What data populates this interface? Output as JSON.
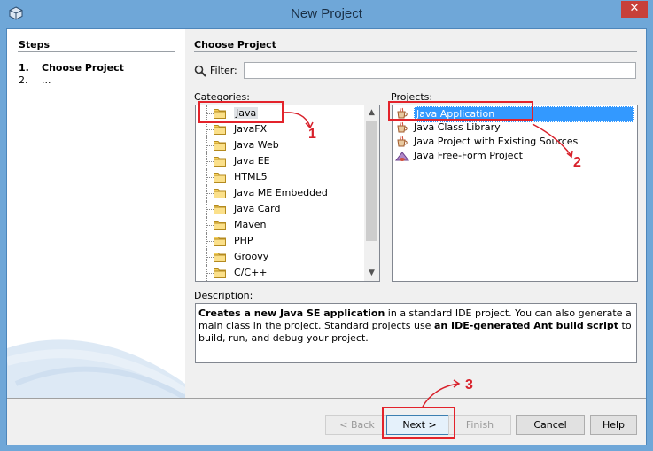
{
  "window": {
    "title": "New Project",
    "close_glyph": "✕"
  },
  "steps": {
    "heading": "Steps",
    "items": [
      {
        "num": "1.",
        "label": "Choose Project"
      },
      {
        "num": "2.",
        "label": "..."
      }
    ]
  },
  "main": {
    "heading": "Choose Project",
    "filter_label": "Filter:",
    "filter_value": "",
    "categories_label": "Categories:",
    "projects_label": "Projects:",
    "categories": [
      "Java",
      "JavaFX",
      "Java Web",
      "Java EE",
      "HTML5",
      "Java ME Embedded",
      "Java Card",
      "Maven",
      "PHP",
      "Groovy",
      "C/C++"
    ],
    "selected_category": "Java",
    "projects": [
      "Java Application",
      "Java Class Library",
      "Java Project with Existing Sources",
      "Java Free-Form Project"
    ],
    "selected_project": "Java Application",
    "description_label": "Description:",
    "description": {
      "b1": "Creates a new Java SE application",
      "t1": " in a standard IDE project. You can also generate a main class in the project. Standard projects use ",
      "b2": "an IDE-generated Ant build script",
      "t2": " to build, run, and debug your project."
    }
  },
  "buttons": {
    "back": "< Back",
    "next": "Next >",
    "finish": "Finish",
    "cancel": "Cancel",
    "help": "Help"
  },
  "annotations": {
    "a1": "1",
    "a2": "2",
    "a3": "3"
  },
  "colors": {
    "accent": "#3399ff",
    "annotation": "#e3232b",
    "titlebar": "#6fa7d8"
  },
  "icons": {
    "app": "netbeans-cube-icon",
    "filter": "magnifier-icon",
    "category": "folder-icon",
    "project": "coffee-cup-icon"
  }
}
